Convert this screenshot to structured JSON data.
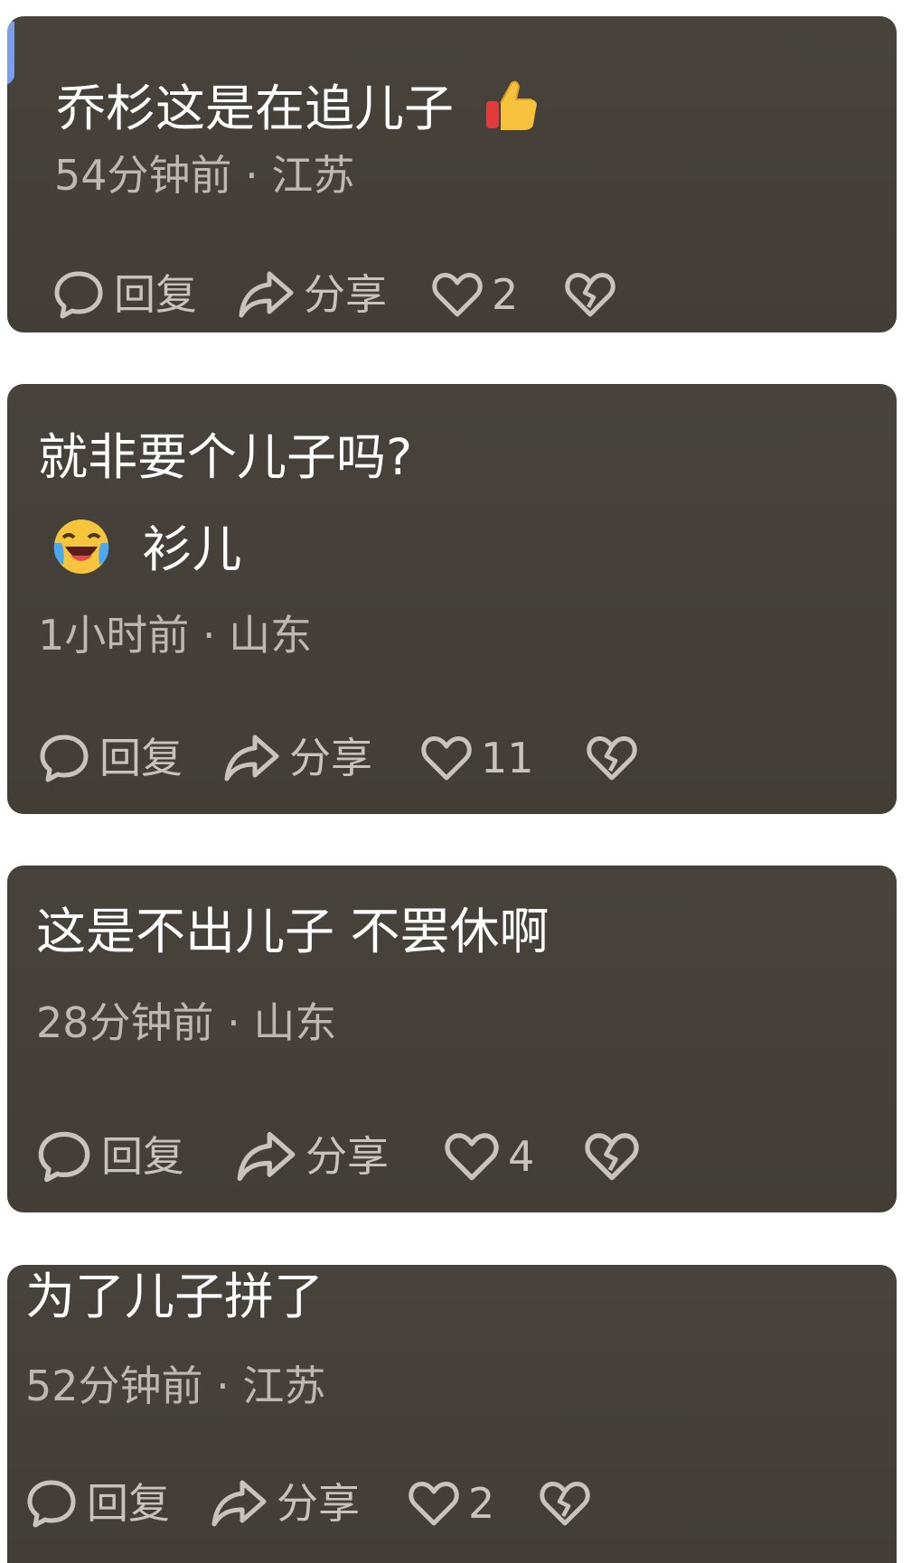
{
  "comments": [
    {
      "text": "乔杉这是在追儿子",
      "emoji": "thumbs-up",
      "meta": "54分钟前 · 江苏",
      "reply": "回复",
      "share": "分享",
      "likes": "2"
    },
    {
      "text": "就非要个儿子吗?",
      "line2": "衫儿",
      "emoji": "laughing-crying-face",
      "meta": "1小时前 · 山东",
      "reply": "回复",
      "share": "分享",
      "likes": "11"
    },
    {
      "text": "这是不出儿子 不罢休啊",
      "meta": "28分钟前 · 山东",
      "reply": "回复",
      "share": "分享",
      "likes": "4"
    },
    {
      "text": "为了儿子拼了",
      "meta": "52分钟前 · 江苏",
      "reply": "回复",
      "share": "分享",
      "likes": "2"
    }
  ],
  "colors": {
    "card": "#45403a",
    "text": "#ffffff",
    "meta": "#bdb8b1",
    "icon": "#c8c3bc",
    "accent": "#7c9ee8"
  }
}
